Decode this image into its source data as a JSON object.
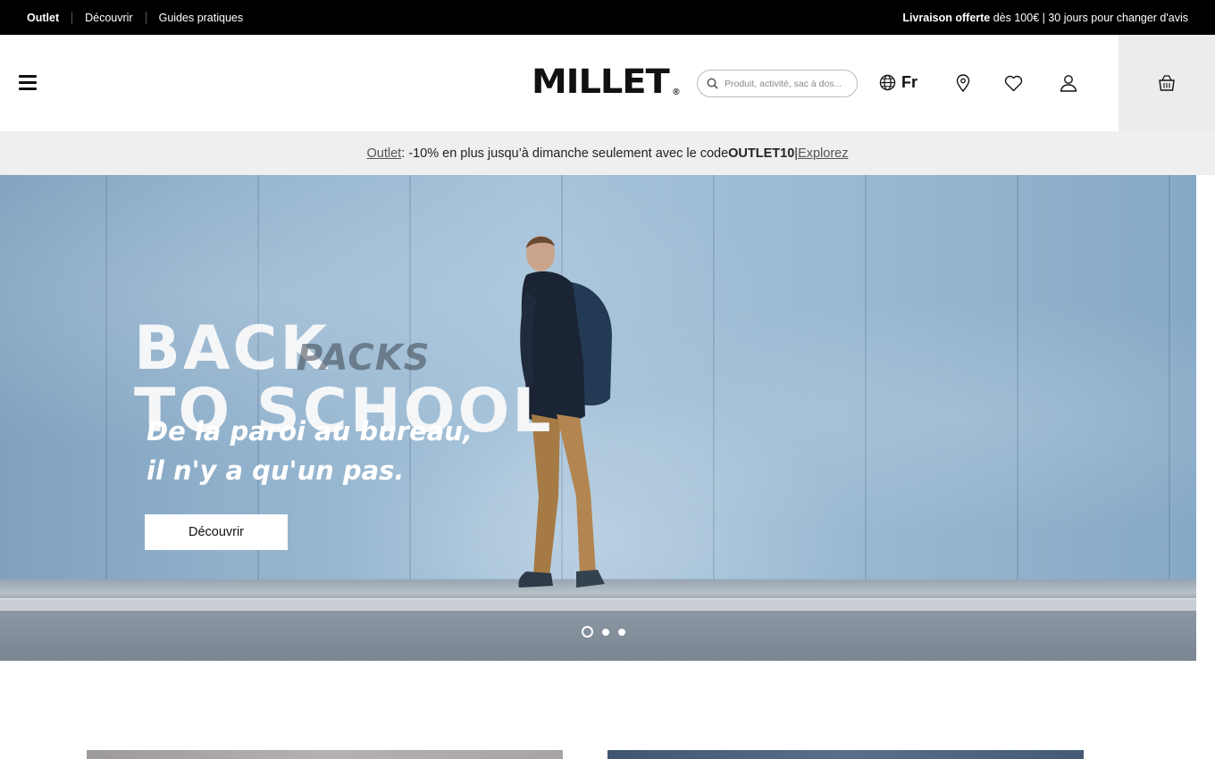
{
  "topbar": {
    "nav": [
      "Outlet",
      "Découvrir",
      "Guides pratiques"
    ],
    "shipping_bold": "Livraison offerte",
    "shipping_rest": " dès 100€ | 30 jours pour changer d'avis"
  },
  "header": {
    "logo": "MILLET",
    "logo_mark": "®",
    "search_placeholder": "Produit, activité, sac à dos...",
    "language": "Fr",
    "icons": [
      "menu-icon",
      "search-icon",
      "globe-icon",
      "store-locator-icon",
      "wishlist-icon",
      "account-icon",
      "cart-icon"
    ]
  },
  "promo": {
    "link1": "Outlet",
    "text": " : -10% en plus jusqu’à dimanche seulement avec le code ",
    "code": "OUTLET10",
    "sep": " | ",
    "link2": "Explorez"
  },
  "hero": {
    "title_line1": "BACK",
    "title_tag": "PACKS",
    "title_line2": "TO SCHOOL",
    "subtitle_line1": "De la paroi au bureau,",
    "subtitle_line2": "il n'y a qu'un pas.",
    "cta": "Découvrir",
    "slides": 3,
    "active_slide": 1
  },
  "colors": {
    "topbar_bg": "#000000",
    "promo_bg": "#efefef",
    "cart_bg": "#ececec"
  }
}
